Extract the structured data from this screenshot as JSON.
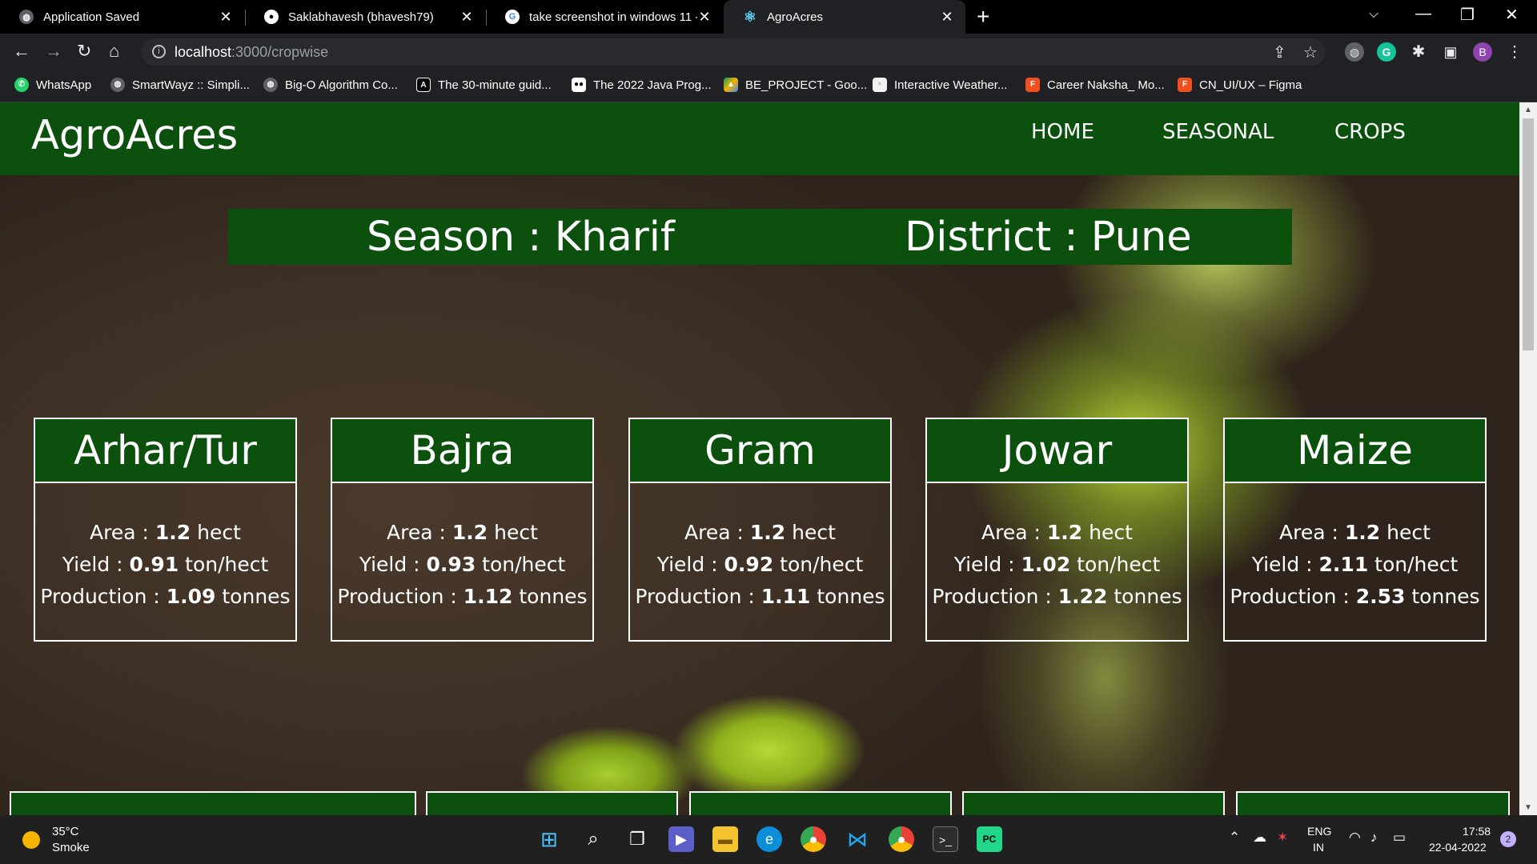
{
  "browser": {
    "tabs": [
      {
        "title": "Application Saved",
        "icon": "globe-icon"
      },
      {
        "title": "Saklabhavesh (bhavesh79)",
        "icon": "github-icon"
      },
      {
        "title": "take screenshot in windows 11 -",
        "icon": "google-icon"
      },
      {
        "title": "AgroAcres",
        "icon": "react-icon"
      }
    ],
    "new_tab": "+",
    "url_host": "localhost",
    "url_path": ":3000/cropwise",
    "profile_initial": "B",
    "bookmarks": [
      {
        "label": "WhatsApp",
        "icon": "whatsapp-icon"
      },
      {
        "label": "SmartWayz :: Simpli...",
        "icon": "globe-icon"
      },
      {
        "label": "Big-O Algorithm Co...",
        "icon": "globe-icon"
      },
      {
        "label": "The 30-minute guid...",
        "icon": "angular-icon"
      },
      {
        "label": "The 2022 Java Prog...",
        "icon": "medium-icon"
      },
      {
        "label": "BE_PROJECT - Goo...",
        "icon": "drive-icon"
      },
      {
        "label": "Interactive Weather...",
        "icon": "page-icon"
      },
      {
        "label": "Career Naksha_ Mo...",
        "icon": "figma-icon"
      },
      {
        "label": "CN_UI/UX – Figma",
        "icon": "figma-icon"
      }
    ]
  },
  "site": {
    "brand": "AgroAcres",
    "nav": [
      "HOME",
      "SEASONAL",
      "CROPS"
    ],
    "season_label": "Season : Kharif",
    "district_label": "District : Pune",
    "labels": {
      "area": "Area : ",
      "yield": "Yield : ",
      "production": "Production : ",
      "area_unit": " hect",
      "yield_unit": " ton/hect",
      "production_unit": " tonnes"
    },
    "crops": [
      {
        "name": "Arhar/Tur",
        "area": "1.2",
        "yield": "0.91",
        "production": "1.09"
      },
      {
        "name": "Bajra",
        "area": "1.2",
        "yield": "0.93",
        "production": "1.12"
      },
      {
        "name": "Gram",
        "area": "1.2",
        "yield": "0.92",
        "production": "1.11"
      },
      {
        "name": "Jowar",
        "area": "1.2",
        "yield": "1.02",
        "production": "1.22"
      },
      {
        "name": "Maize",
        "area": "1.2",
        "yield": "2.11",
        "production": "2.53"
      }
    ],
    "brand_color": "#0b500c"
  },
  "taskbar": {
    "temperature": "35°C",
    "weather": "Smoke",
    "language": "ENG",
    "region": "IN",
    "time": "17:58",
    "date": "22-04-2022",
    "notification_count": "2",
    "apps": [
      "start-icon",
      "search-icon",
      "task-view-icon",
      "teams-icon",
      "file-explorer-icon",
      "edge-icon",
      "chrome-icon",
      "vscode-icon",
      "chrome-profile-icon",
      "terminal-icon",
      "pycharm-icon"
    ]
  }
}
